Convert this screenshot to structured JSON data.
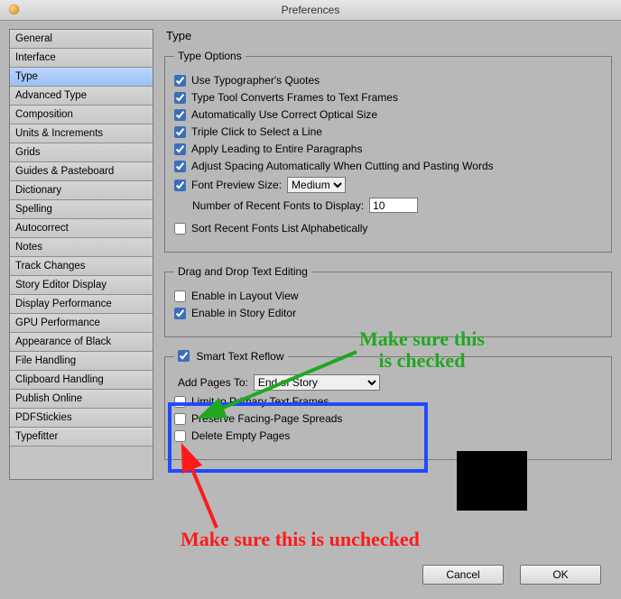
{
  "window": {
    "title": "Preferences"
  },
  "sidebar": {
    "items": [
      "General",
      "Interface",
      "Type",
      "Advanced Type",
      "Composition",
      "Units & Increments",
      "Grids",
      "Guides & Pasteboard",
      "Dictionary",
      "Spelling",
      "Autocorrect",
      "Notes",
      "Track Changes",
      "Story Editor Display",
      "Display Performance",
      "GPU Performance",
      "Appearance of Black",
      "File Handling",
      "Clipboard Handling",
      "Publish Online",
      "PDFStickies",
      "Typefitter"
    ],
    "selectedIndex": 2
  },
  "content": {
    "heading": "Type",
    "typeOptions": {
      "legend": "Type Options",
      "typographersQuotes": {
        "label": "Use Typographer's Quotes",
        "checked": true
      },
      "convertFrames": {
        "label": "Type Tool Converts Frames to Text Frames",
        "checked": true
      },
      "opticalSize": {
        "label": "Automatically Use Correct Optical Size",
        "checked": true
      },
      "tripleClick": {
        "label": "Triple Click to Select a Line",
        "checked": true
      },
      "applyLeading": {
        "label": "Apply Leading to Entire Paragraphs",
        "checked": true
      },
      "adjustSpacing": {
        "label": "Adjust Spacing Automatically When Cutting and Pasting Words",
        "checked": true
      },
      "fontPreview": {
        "label": "Font Preview Size:",
        "checked": true,
        "value": "Medium"
      },
      "recentFonts": {
        "label": "Number of Recent Fonts to Display:",
        "value": "10"
      },
      "sortRecent": {
        "label": "Sort Recent Fonts List Alphabetically",
        "checked": false
      }
    },
    "dragDrop": {
      "legend": "Drag and Drop Text Editing",
      "layoutView": {
        "label": "Enable in Layout View",
        "checked": false
      },
      "storyEditor": {
        "label": "Enable in Story Editor",
        "checked": true
      }
    },
    "smartReflow": {
      "legend": "Smart Text Reflow",
      "enable": {
        "checked": true
      },
      "addPagesTo": {
        "label": "Add Pages To:",
        "value": "End of Story"
      },
      "limitPrimary": {
        "label": "Limit to Primary Text Frames",
        "checked": false
      },
      "preserveFacing": {
        "label": "Preserve Facing-Page Spreads",
        "checked": false
      },
      "deleteEmpty": {
        "label": "Delete Empty Pages",
        "checked": false
      }
    }
  },
  "annotations": {
    "checkedText": "Make sure this\nis checked",
    "uncheckedText": "Make sure this is unchecked"
  },
  "buttons": {
    "cancel": "Cancel",
    "ok": "OK"
  }
}
